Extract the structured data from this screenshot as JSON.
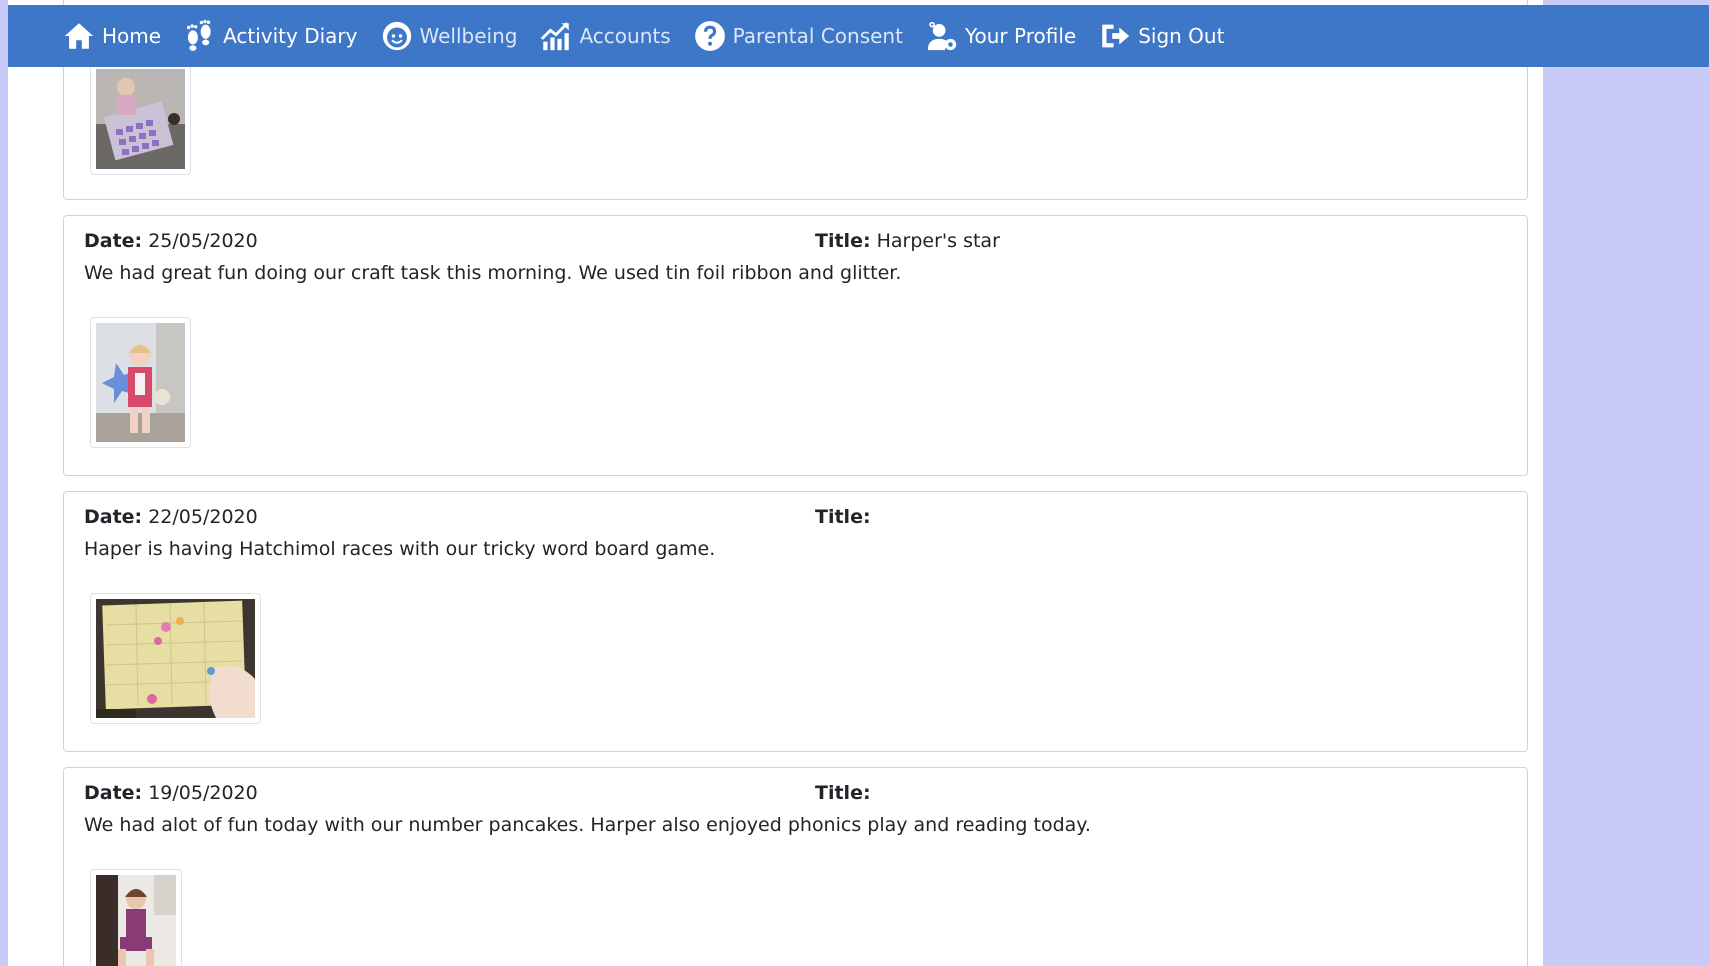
{
  "nav": {
    "items": [
      {
        "label": "Home",
        "icon": "home-icon"
      },
      {
        "label": "Activity Diary",
        "icon": "footprints-icon"
      },
      {
        "label": "Wellbeing",
        "icon": "smiley-face-icon"
      },
      {
        "label": "Accounts",
        "icon": "chart-up-icon"
      },
      {
        "label": "Parental Consent",
        "icon": "question-circle-icon"
      },
      {
        "label": "Your Profile",
        "icon": "user-gear-icon"
      },
      {
        "label": "Sign Out",
        "icon": "sign-out-icon"
      }
    ]
  },
  "labels": {
    "date": "Date:",
    "title": "Title:"
  },
  "entries": [
    {
      "date": "",
      "title": "",
      "description": ""
    },
    {
      "date": "25/05/2020",
      "title": "Harper's star",
      "description": "We had great fun doing our craft task this morning. We used tin foil ribbon and glitter."
    },
    {
      "date": "22/05/2020",
      "title": "",
      "description": "Haper is having Hatchimol races with our tricky word board game."
    },
    {
      "date": "19/05/2020",
      "title": "",
      "description": "We had alot of fun today with our number pancakes. Harper also enjoyed phonics play and reading today."
    }
  ],
  "colors": {
    "navbar": "#3e77c8",
    "side_panel": "#c8cbf8",
    "text": "#212529"
  }
}
